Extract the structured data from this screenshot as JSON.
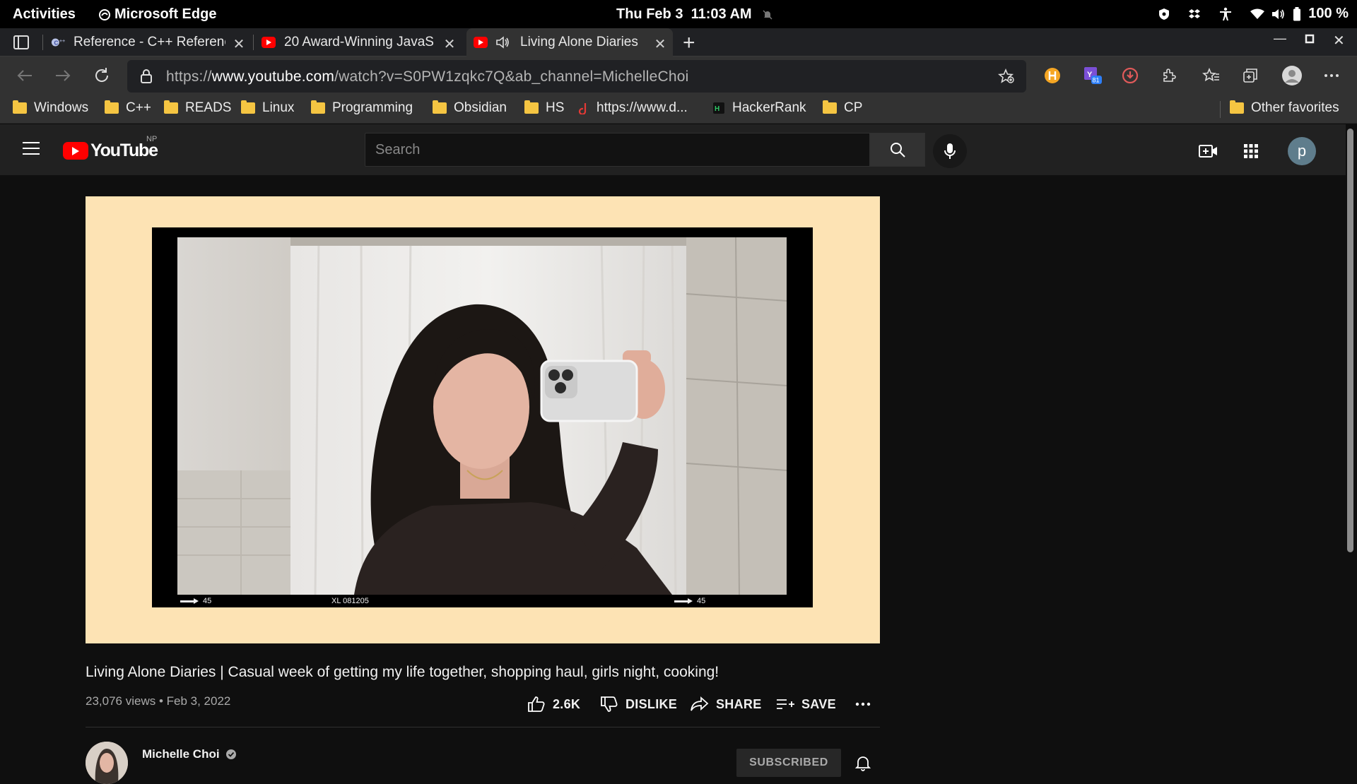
{
  "system_bar": {
    "activities": "Activities",
    "app_name": "Microsoft Edge",
    "date": "Thu Feb 3",
    "time": "11:03 AM",
    "battery": "100 %"
  },
  "tabs": [
    {
      "title": "Reference - C++ Referenc",
      "icon": "cplusplus-icon",
      "active": false
    },
    {
      "title": "20 Award-Winning JavaS",
      "icon": "youtube-icon",
      "active": false
    },
    {
      "title": "Living Alone Diaries",
      "icon": "youtube-icon",
      "active": true,
      "audio": true
    }
  ],
  "address_bar": {
    "url_prefix": "https://",
    "url_domain": "www.youtube.com",
    "url_path": "/watch?v=S0PW1zqkc7Q&ab_channel=MichelleChoi",
    "extension_badge": "81"
  },
  "bookmarks": {
    "items": [
      "Windows",
      "C++",
      "READS",
      "Linux",
      "Programming",
      "Obsidian",
      "HS",
      "https://www.d...",
      "HackerRank",
      "CP"
    ],
    "other": "Other favorites"
  },
  "youtube": {
    "logo_text": "YouTube",
    "country_code": "NP",
    "search_placeholder": "Search",
    "avatar_letter": "p"
  },
  "video": {
    "film_left": "45",
    "film_center": "XL 081205",
    "film_right": "45",
    "title": "Living Alone Diaries | Casual week of getting my life together, shopping haul, girls night, cooking!",
    "views": "23,076 views",
    "date": "Feb 3, 2022",
    "likes": "2.6K",
    "dislike_label": "DISLIKE",
    "share_label": "SHARE",
    "save_label": "SAVE"
  },
  "channel": {
    "name": "Michelle Choi",
    "subscribe_label": "SUBSCRIBED"
  },
  "colors": {
    "youtube_red": "#ff0000",
    "player_background": "#fde3b4",
    "folder_yellow": "#f5c542"
  }
}
